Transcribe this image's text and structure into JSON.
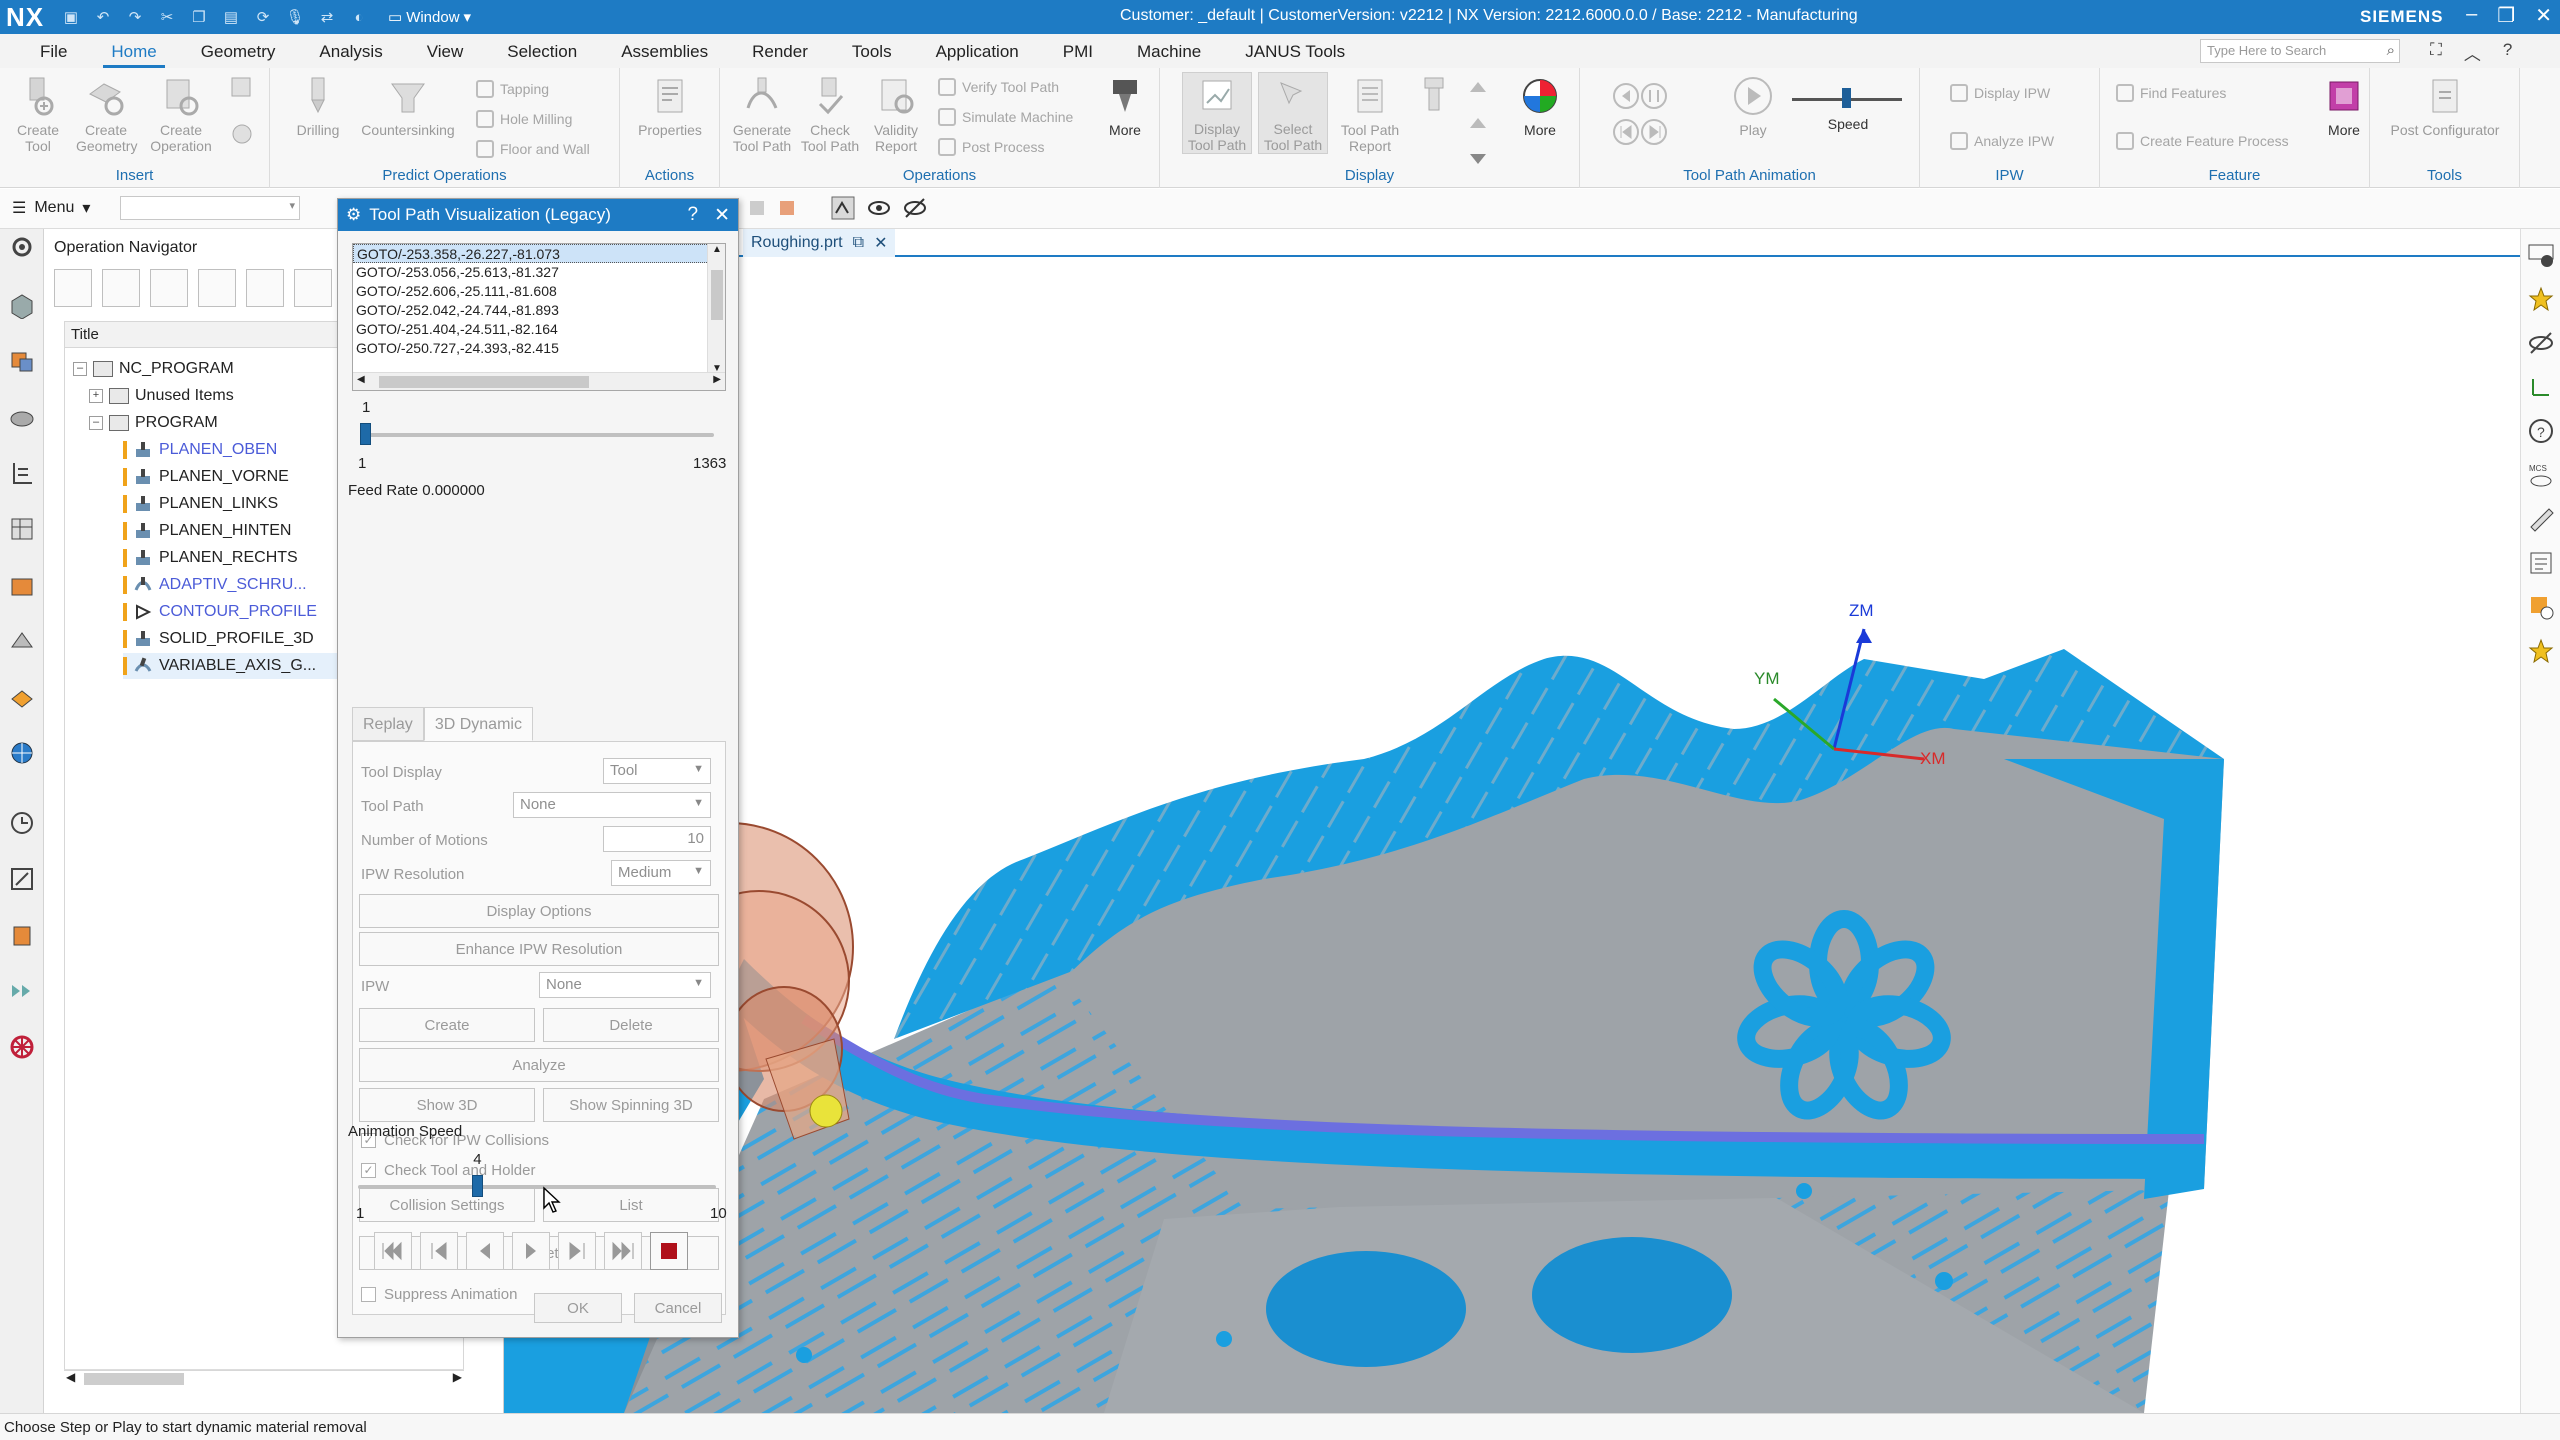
{
  "titlebar": {
    "logo": "NX",
    "window_menu": "Window",
    "title": "Customer: _default | CustomerVersion: v2212 | NX Version: 2212.6000.0.0 / Base: 2212 - Manufacturing",
    "brand": "SIEMENS",
    "minimize": "–",
    "restore": "❐",
    "close": "✕"
  },
  "ribbon_tabs": [
    "File",
    "Home",
    "Geometry",
    "Analysis",
    "View",
    "Selection",
    "Assemblies",
    "Render",
    "Tools",
    "Application",
    "PMI",
    "Machine",
    "JANUS Tools"
  ],
  "active_tab": "Home",
  "search": {
    "placeholder": "Type Here to Search"
  },
  "ribbon": {
    "insert": {
      "label": "Insert",
      "create_tool": "Create Tool",
      "create_geometry": "Create Geometry",
      "create_operation": "Create Operation"
    },
    "predict": {
      "label": "Predict Operations",
      "drilling": "Drilling",
      "countersinking": "Countersinking",
      "tapping": "Tapping",
      "hole_milling": "Hole Milling",
      "floor_and_wall": "Floor and Wall"
    },
    "actions": {
      "label": "Actions",
      "properties": "Properties"
    },
    "operations": {
      "label": "Operations",
      "generate": "Generate Tool Path",
      "check": "Check Tool Path",
      "validity": "Validity Report",
      "verify": "Verify Tool Path",
      "simulate": "Simulate Machine",
      "post": "Post Process",
      "more": "More"
    },
    "display": {
      "label": "Display",
      "display_tp": "Display Tool Path",
      "select_tp": "Select Tool Path",
      "tp_report": "Tool Path Report",
      "more": "More"
    },
    "animation": {
      "label": "Tool Path Animation",
      "play": "Play",
      "speed": "Speed"
    },
    "ipw": {
      "label": "IPW",
      "display_ipw": "Display IPW",
      "analyze_ipw": "Analyze IPW"
    },
    "feature": {
      "label": "Feature",
      "find": "Find Features",
      "create_process": "Create Feature Process",
      "more": "More"
    },
    "tools": {
      "label": "Tools",
      "post_config": "Post Configurator"
    }
  },
  "toolrow": {
    "menu": "Menu"
  },
  "navigator": {
    "title": "Operation Navigator",
    "column": "Title",
    "rows": [
      {
        "label": "NC_PROGRAM"
      },
      {
        "label": "Unused Items"
      },
      {
        "label": "PROGRAM"
      },
      {
        "label": "PLANEN_OBEN"
      },
      {
        "label": "PLANEN_VORNE"
      },
      {
        "label": "PLANEN_LINKS"
      },
      {
        "label": "PLANEN_HINTEN"
      },
      {
        "label": "PLANEN_RECHTS"
      },
      {
        "label": "ADAPTIV_SCHRU..."
      },
      {
        "label": "CONTOUR_PROFILE"
      },
      {
        "label": "SOLID_PROFILE_3D"
      },
      {
        "label": "VARIABLE_AXIS_G..."
      }
    ]
  },
  "dialog": {
    "title": "Tool Path Visualization (Legacy)",
    "help": "?",
    "close": "✕",
    "goto_lines": [
      "GOTO/-253.358,-26.227,-81.073",
      "GOTO/-253.056,-25.613,-81.327",
      "GOTO/-252.606,-25.111,-81.608",
      "GOTO/-252.042,-24.744,-81.893",
      "GOTO/-251.404,-24.511,-82.164",
      "GOTO/-250.727,-24.393,-82.415"
    ],
    "motion_slider": {
      "current": "1",
      "min": "1",
      "max": "1363",
      "fraction": 0.0
    },
    "feed_rate": "Feed Rate 0.000000",
    "tabs": [
      "Replay",
      "3D Dynamic"
    ],
    "tool_display_label": "Tool Display",
    "tool_display_value": "Tool",
    "tool_path_label": "Tool Path",
    "tool_path_value": "None",
    "num_motions_label": "Number of Motions",
    "num_motions_value": "10",
    "ipw_res_label": "IPW Resolution",
    "ipw_res_value": "Medium",
    "display_options": "Display Options",
    "enhance_ipw": "Enhance IPW Resolution",
    "ipw_label": "IPW",
    "ipw_value": "None",
    "create": "Create",
    "delete": "Delete",
    "analyze": "Analyze",
    "show_3d": "Show 3D",
    "show_spinning_3d": "Show Spinning 3D",
    "check_ipw": "Check for IPW Collisions",
    "check_tool_holder": "Check Tool and Holder",
    "collision_settings": "Collision Settings",
    "list": "List",
    "reset": "Reset",
    "suppress_animation": "Suppress Animation",
    "animation_speed_label": "Animation Speed",
    "speed_slider": {
      "current": "4",
      "min": "1",
      "max": "10",
      "fraction": 0.333
    },
    "ok": "OK",
    "cancel": "Cancel"
  },
  "doc_tab": {
    "label": "Roughing.prt"
  },
  "viewport": {
    "axis_z": "ZM",
    "axis_y": "YM",
    "axis_x": "XM"
  },
  "statusbar": {
    "text": "Choose Step or Play to start dynamic material removal"
  },
  "colors": {
    "accent": "#1e7bc4",
    "machined": "#1a9fe0",
    "stock": "#9ea3a8",
    "tool": "#d98a6a"
  }
}
